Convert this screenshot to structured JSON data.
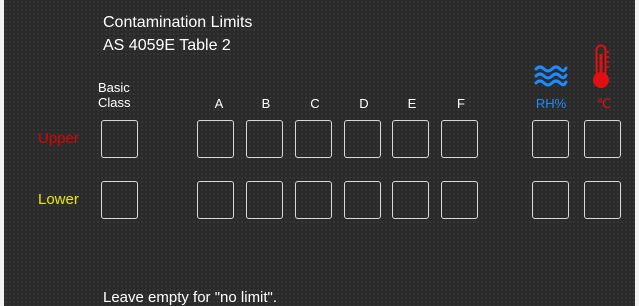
{
  "title": {
    "line1": "Contamination Limits",
    "line2": "AS 4059E Table 2"
  },
  "columns": {
    "basic_line1": "Basic",
    "basic_line2": "Class",
    "a": "A",
    "b": "B",
    "c": "C",
    "d": "D",
    "e": "E",
    "f": "F",
    "rh": "RH%",
    "temp": "℃"
  },
  "rows": {
    "upper": "Upper",
    "lower": "Lower"
  },
  "inputs": {
    "upper": {
      "basic": "",
      "a": "",
      "b": "",
      "c": "",
      "d": "",
      "e": "",
      "f": "",
      "rh": "",
      "temp": ""
    },
    "lower": {
      "basic": "",
      "a": "",
      "b": "",
      "c": "",
      "d": "",
      "e": "",
      "f": "",
      "rh": "",
      "temp": ""
    }
  },
  "icons": {
    "humidity": "humidity-waves-icon",
    "temperature": "thermometer-icon"
  },
  "colors": {
    "upper_label": "#e00000",
    "lower_label": "#e8e800",
    "humidity_accent": "#1a8cff",
    "temperature_accent": "#e01010"
  },
  "footer": "Leave empty for \"no limit\"."
}
